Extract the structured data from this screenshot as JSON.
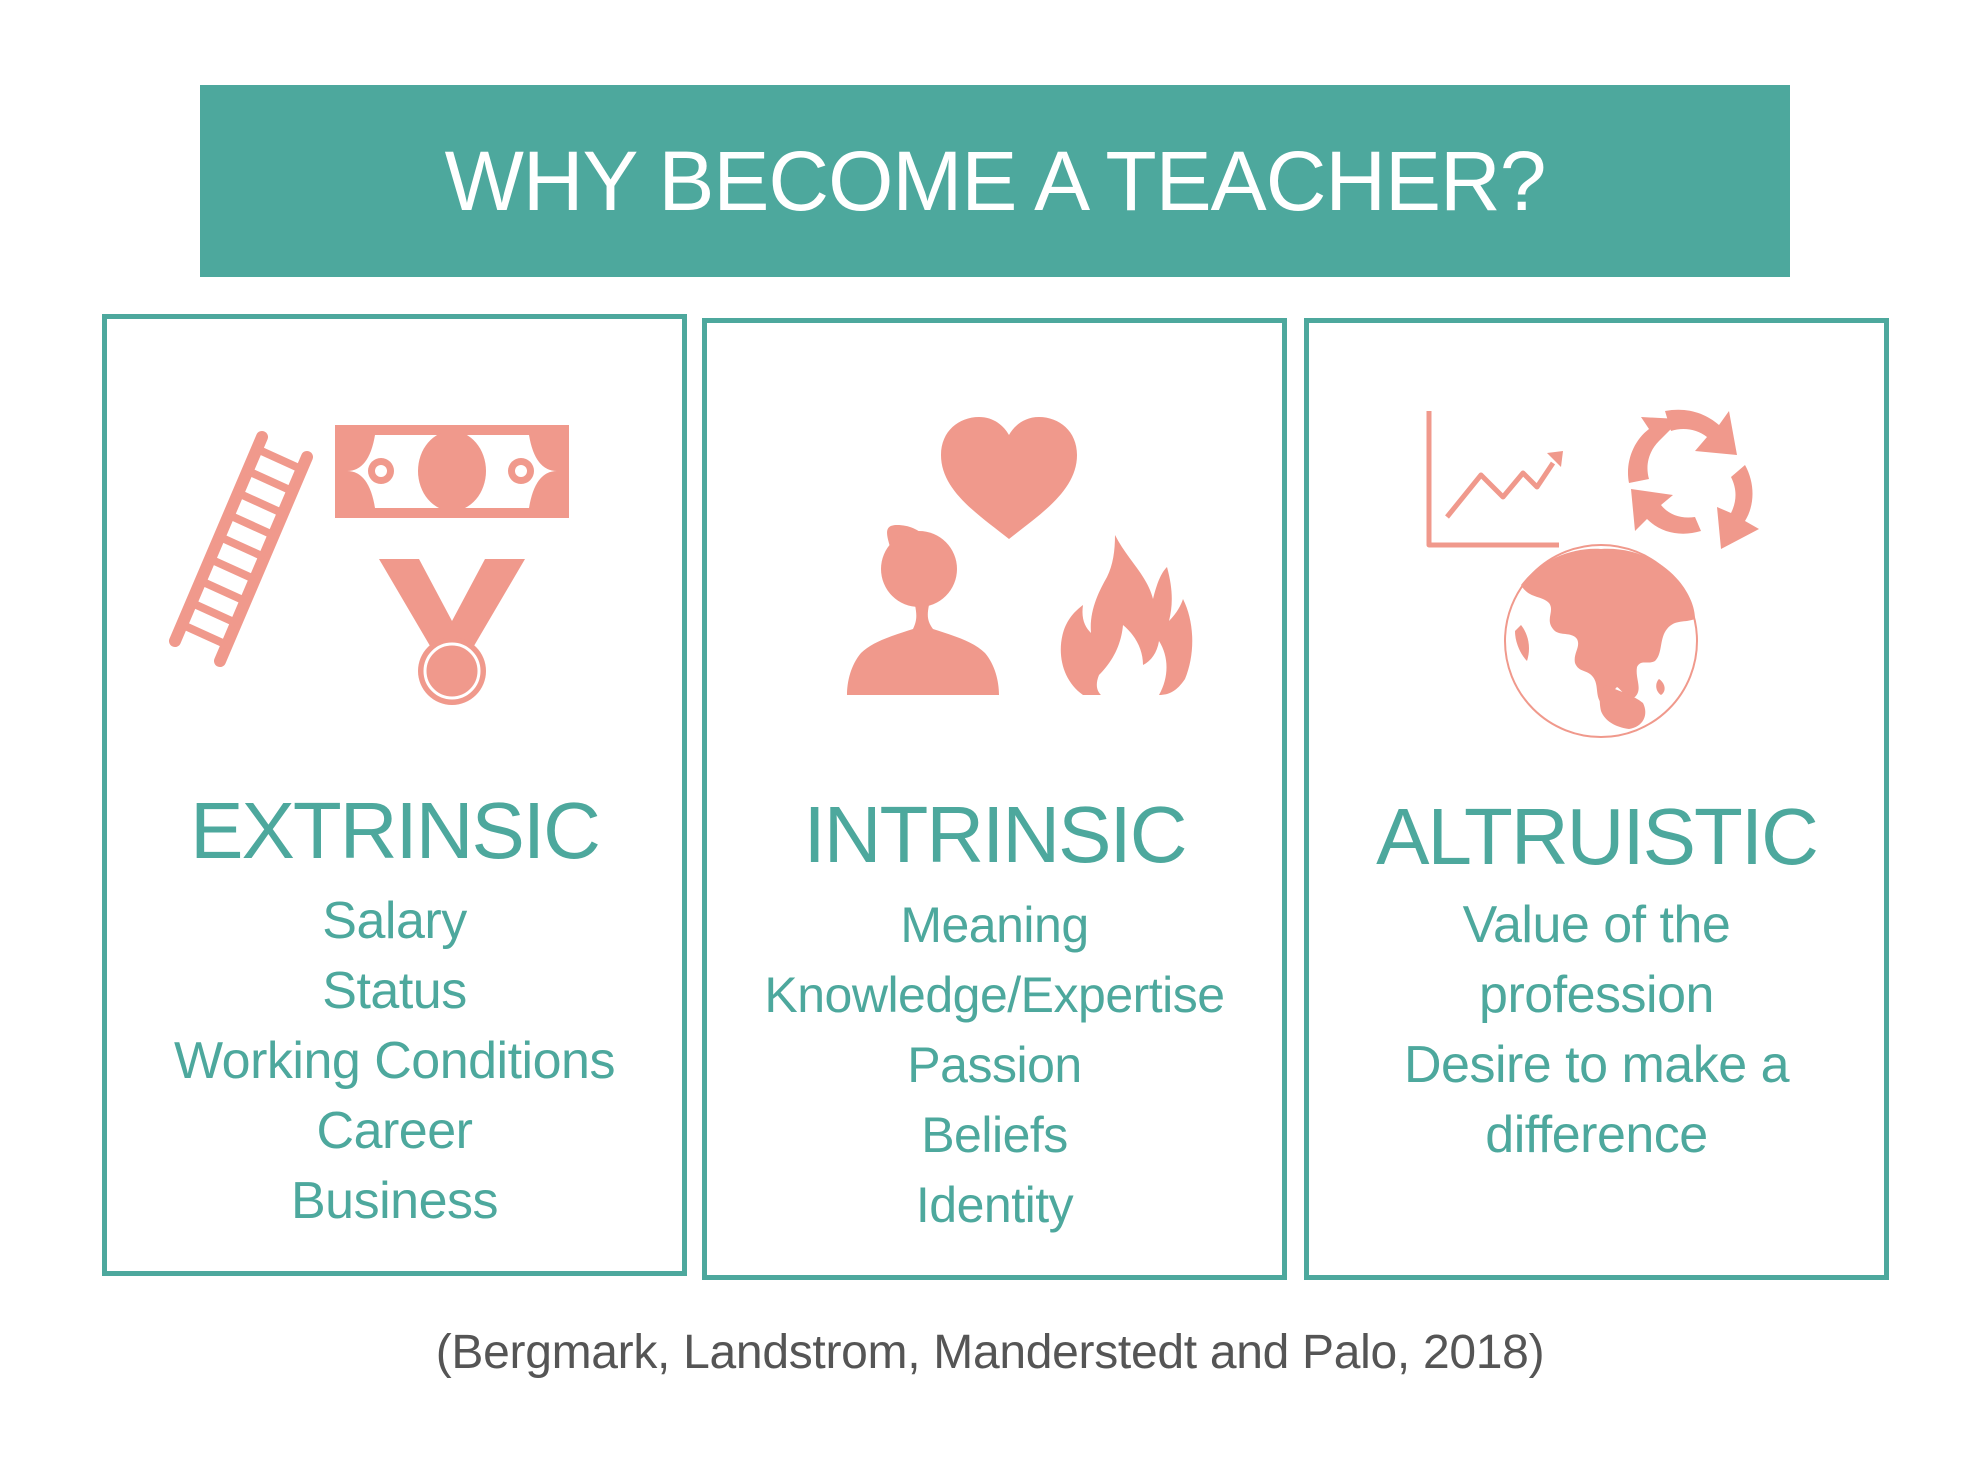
{
  "title": "WHY BECOME A TEACHER?",
  "colors": {
    "accent": "#4da89d",
    "icon": "#f0998c",
    "citation": "#555555",
    "background": "#ffffff"
  },
  "panels": [
    {
      "heading": "EXTRINSIC",
      "items": [
        "Salary",
        "Status",
        "Working Conditions",
        "Career",
        "Business"
      ],
      "icons": [
        "ladder-icon",
        "banknote-icon",
        "medal-icon"
      ]
    },
    {
      "heading": "INTRINSIC",
      "items": [
        "Meaning",
        "Knowledge/Expertise",
        "Passion",
        "Beliefs",
        "Identity"
      ],
      "icons": [
        "heart-icon",
        "person-silhouette-icon",
        "flame-icon"
      ]
    },
    {
      "heading": "ALTRUISTIC",
      "items": [
        "Value of the",
        "profession",
        "Desire to make a",
        "difference"
      ],
      "icons": [
        "growth-chart-icon",
        "recycle-arrows-icon",
        "globe-icon"
      ]
    }
  ],
  "citation": "(Bergmark, Landstrom, Manderstedt and Palo, 2018)"
}
